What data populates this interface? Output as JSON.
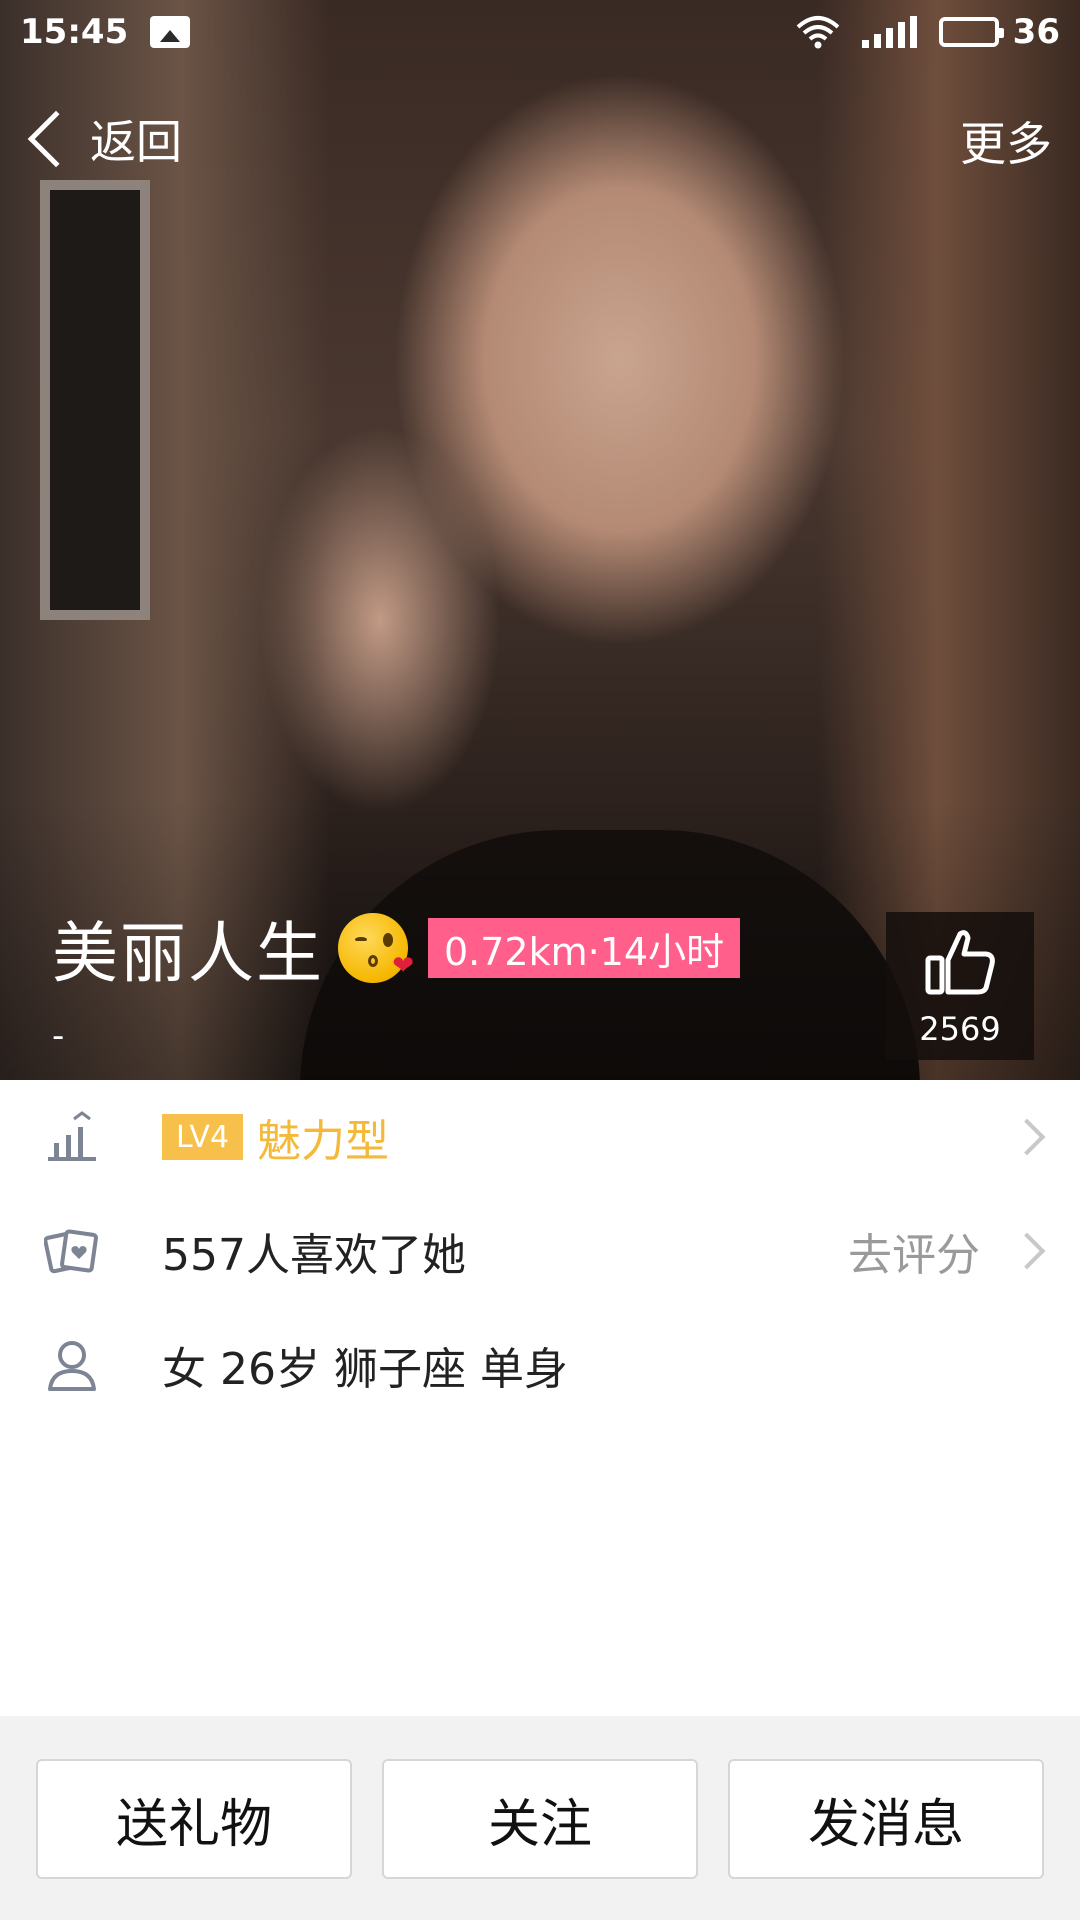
{
  "status_bar": {
    "time": "15:45",
    "battery": "36",
    "battery_fraction": 0.36
  },
  "nav": {
    "back_label": "返回",
    "more_label": "更多"
  },
  "profile": {
    "name": "美丽人生",
    "emoji": "kiss-emoji-icon",
    "distance_time": "0.72km·14小时",
    "signature": "-",
    "like_count": "2569"
  },
  "info": {
    "level_badge": "LV4",
    "level_type": "魅力型",
    "likes_text": "557人喜欢了她",
    "rate_action": "去评分",
    "basic_info": "女 26岁 狮子座 单身"
  },
  "actions": {
    "gift": "送礼物",
    "follow": "关注",
    "message": "发消息"
  },
  "colors": {
    "distance_badge": "#ff5f8a",
    "level_badge": "#f7c04a",
    "level_text": "#f5b93a",
    "bottom_bar_bg": "#f2f2f2"
  }
}
